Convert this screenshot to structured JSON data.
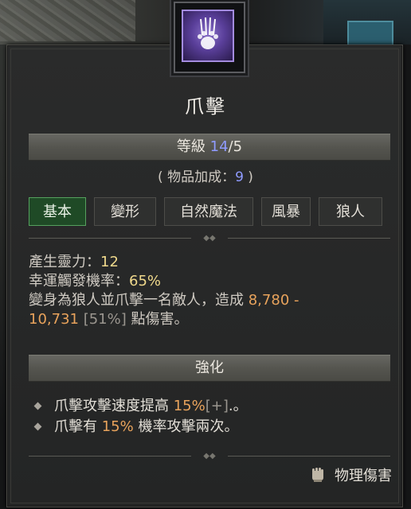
{
  "skill": {
    "name": "爪擊",
    "level_label": "等級",
    "level_current": "14",
    "level_max": "/5",
    "bonus_prefix": "( 物品加成：",
    "bonus_value": "9",
    "bonus_suffix": " )"
  },
  "tags": [
    "基本",
    "變形",
    "自然魔法",
    "風暴",
    "狼人"
  ],
  "active_tag": "基本",
  "stats": {
    "spirit_label": "產生靈力：",
    "spirit_value": "12",
    "luck_label": "幸運觸發機率：",
    "luck_value": "65%",
    "desc_prefix": "變身為狼人並爪擊一名敵人，造成 ",
    "desc_damage": "8,780 -",
    "desc_damage2": "10,731",
    "desc_bracket": " [51%] ",
    "desc_suffix": "點傷害。"
  },
  "enhancement": {
    "title": "強化",
    "bullet1_prefix": "爪擊攻擊速度提高 ",
    "bullet1_value": "15%",
    "bullet1_plus": "[+]",
    "bullet1_suffix": ".。",
    "bullet2_prefix": "爪擊有 ",
    "bullet2_value": "15%",
    "bullet2_suffix": " 機率攻擊兩次。"
  },
  "damage_type": {
    "label": "物理傷害",
    "icon": "fist-icon"
  },
  "colors": {
    "accent_level": "#8f9bff",
    "stat_value": "#f0d98c",
    "damage_value": "#e8a35c",
    "active_tag_bg": "#1f4a26"
  }
}
